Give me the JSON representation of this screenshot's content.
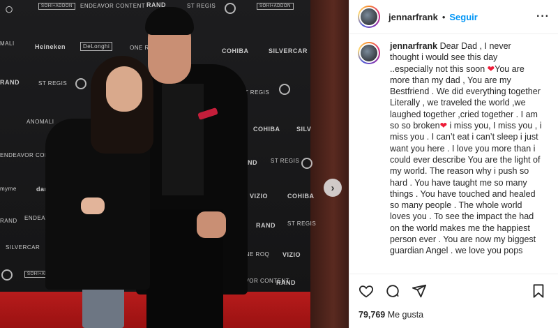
{
  "post": {
    "media": {
      "sponsor_logos": [
        "Heineken",
        "DeLonghi",
        "COHIBA",
        "SILVERCAR",
        "RAND",
        "ST REGIS",
        "ANOMALI",
        "ENDEAVOR CONTENT",
        "VIZIO",
        "dama",
        "ONE ROQ",
        "MALI",
        "myme"
      ]
    },
    "header": {
      "username": "jennarfrank",
      "separator": "•",
      "follow_label": "Seguir",
      "more_label": "···"
    },
    "caption": {
      "username": "jennarfrank",
      "text_part1": "Dear Dad , I never thought i would see this day ..especially not this soon ",
      "heart1": "❤",
      "text_part2": "You are more than my dad , You are my Bestfriend . We did everything together Literally , we traveled the world ,we laughed together ,cried together . I am so so broken",
      "heart2": "❤",
      "text_part3": " i miss you, I miss you , i miss you . I can’t eat i can’t sleep i just want you here . I love you more than i could ever describe You are the light of my world. The reason why i push so hard . You have taught me so many things . You have touched and healed so many people . The whole world loves you . To see the impact the had on the world makes me the happiest person ever . You are now my biggest guardian Angel . we love you pops"
    },
    "likes": {
      "count": "79,769",
      "label": "Me gusta"
    }
  },
  "icons": {
    "like": "heart-outline-icon",
    "comment": "speech-bubble-icon",
    "share": "paper-plane-icon",
    "save": "bookmark-icon",
    "next": "chevron-right-icon"
  },
  "colors": {
    "follow": "#0095f6",
    "heart": "#ed1c38",
    "carpet": "#b71c1c"
  }
}
